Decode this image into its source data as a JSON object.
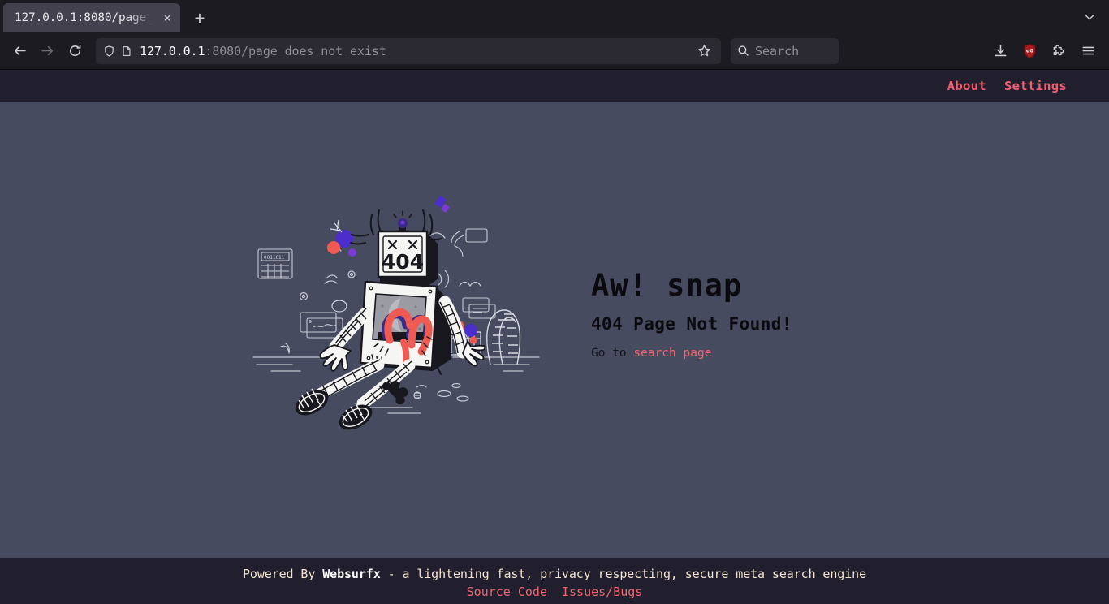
{
  "browser": {
    "tab": {
      "title": "127.0.0.1:8080/page_d",
      "close_label": "×"
    },
    "new_tab_label": "+",
    "url": {
      "host": "127.0.0.1",
      "rest": ":8080/page_does_not_exist"
    },
    "search_placeholder": "Search"
  },
  "header": {
    "nav": [
      {
        "label": "About"
      },
      {
        "label": "Settings"
      }
    ]
  },
  "main": {
    "heading": "Aw! snap",
    "subheading": "404 Page Not Found!",
    "go_to_prefix": "Go to ",
    "go_to_link": "search page",
    "robot_screen_text": "404"
  },
  "footer": {
    "powered_by_prefix": "Powered By ",
    "brand": "Websurfx",
    "tagline": " - a lightening fast, privacy respecting, secure meta search engine",
    "links": [
      {
        "label": "Source Code"
      },
      {
        "label": "Issues/Bugs"
      }
    ]
  },
  "colors": {
    "page_bg": "#474b5f",
    "bar_bg": "#211f2e",
    "accent": "#f06570",
    "footer_text": "#f5e6cf",
    "chrome_bg": "#1c1b22"
  }
}
